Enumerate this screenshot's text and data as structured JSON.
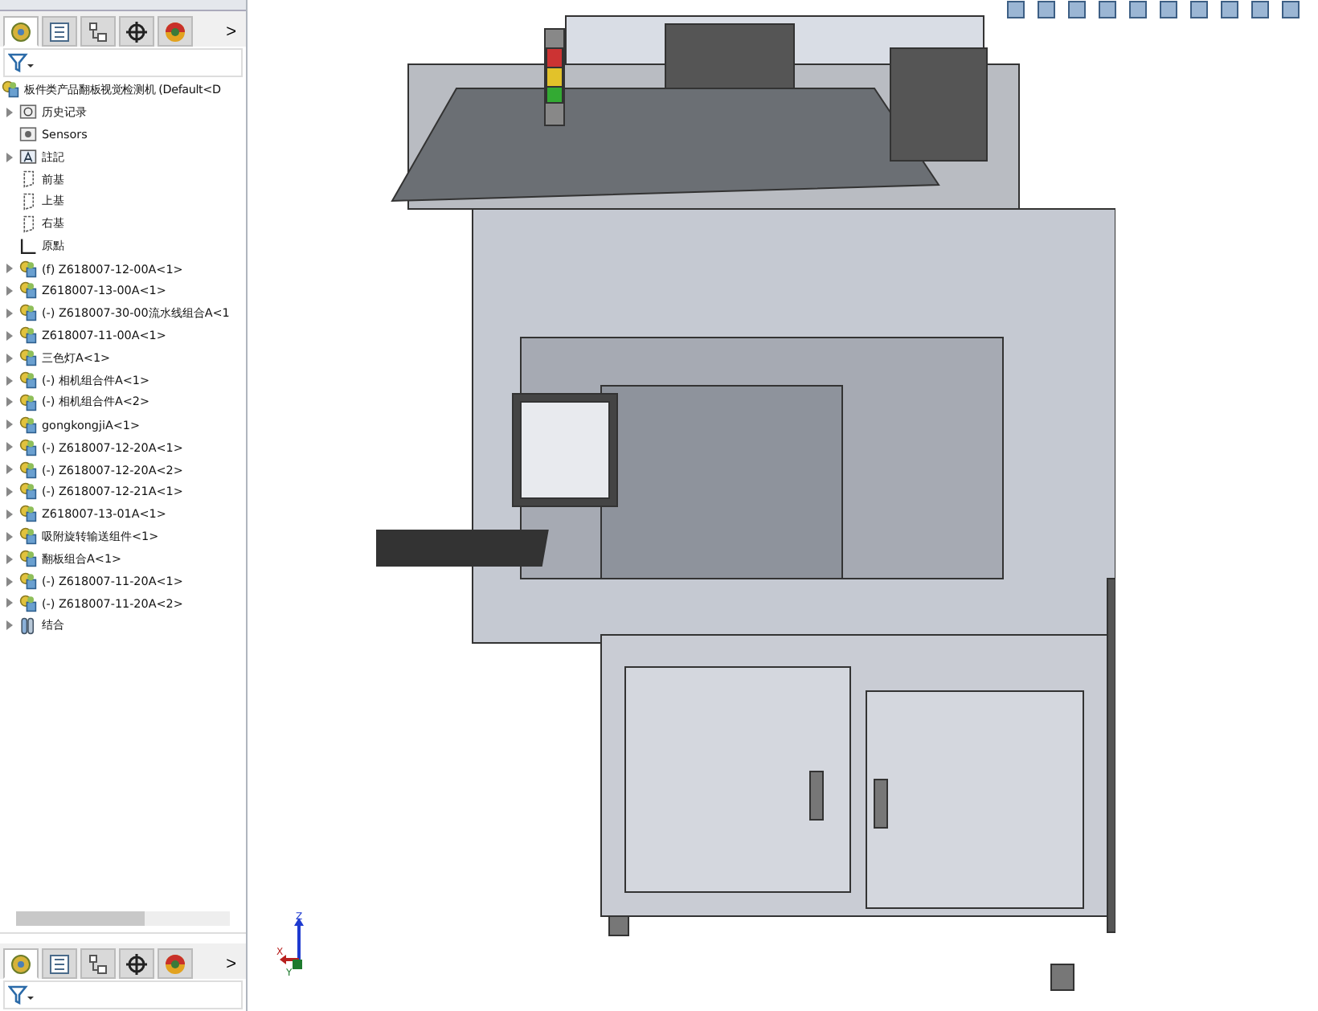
{
  "feature_tree": {
    "root": {
      "label": "板件类产品翻板视觉检测机 (Default<D",
      "kind": "assembly",
      "children": [
        {
          "label": "历史记录",
          "kind": "history",
          "collapsed": true
        },
        {
          "label": "Sensors",
          "kind": "sensor",
          "collapsed": false
        },
        {
          "label": "註記",
          "kind": "annotation",
          "collapsed": true
        },
        {
          "label": "前基",
          "kind": "plane",
          "collapsed": false
        },
        {
          "label": "上基",
          "kind": "plane",
          "collapsed": false
        },
        {
          "label": "右基",
          "kind": "plane",
          "collapsed": false
        },
        {
          "label": "原點",
          "kind": "origin",
          "collapsed": false
        },
        {
          "label": "(f) Z618007-12-00A<1>",
          "kind": "assembly",
          "collapsed": true
        },
        {
          "label": "Z618007-13-00A<1>",
          "kind": "assembly",
          "collapsed": true
        },
        {
          "label": "(-) Z618007-30-00流水线组合A<1",
          "kind": "assembly",
          "collapsed": true
        },
        {
          "label": "Z618007-11-00A<1>",
          "kind": "assembly",
          "collapsed": true
        },
        {
          "label": "三色灯A<1>",
          "kind": "assembly",
          "collapsed": true
        },
        {
          "label": "(-) 相机组合件A<1>",
          "kind": "assembly",
          "collapsed": true
        },
        {
          "label": "(-) 相机组合件A<2>",
          "kind": "assembly",
          "collapsed": true
        },
        {
          "label": "gongkongjiA<1>",
          "kind": "assembly",
          "collapsed": true
        },
        {
          "label": "(-) Z618007-12-20A<1>",
          "kind": "assembly",
          "collapsed": true
        },
        {
          "label": "(-) Z618007-12-20A<2>",
          "kind": "assembly",
          "collapsed": true
        },
        {
          "label": "(-) Z618007-12-21A<1>",
          "kind": "assembly",
          "collapsed": true
        },
        {
          "label": "Z618007-13-01A<1>",
          "kind": "assembly",
          "collapsed": true
        },
        {
          "label": "吸附旋转输送组件<1>",
          "kind": "assembly",
          "collapsed": true
        },
        {
          "label": "翻板组合A<1>",
          "kind": "assembly",
          "collapsed": true
        },
        {
          "label": "(-) Z618007-11-20A<1>",
          "kind": "assembly",
          "collapsed": true
        },
        {
          "label": "(-) Z618007-11-20A<2>",
          "kind": "assembly",
          "collapsed": true
        },
        {
          "label": "结合",
          "kind": "mates",
          "collapsed": true
        }
      ]
    }
  },
  "panel_tabs": [
    {
      "selected": true
    },
    {
      "selected": false
    },
    {
      "selected": false
    },
    {
      "selected": false
    },
    {
      "selected": false
    }
  ],
  "expand_arrow": ">",
  "triad": {
    "z": "Z",
    "x": "X",
    "y": "Y"
  }
}
